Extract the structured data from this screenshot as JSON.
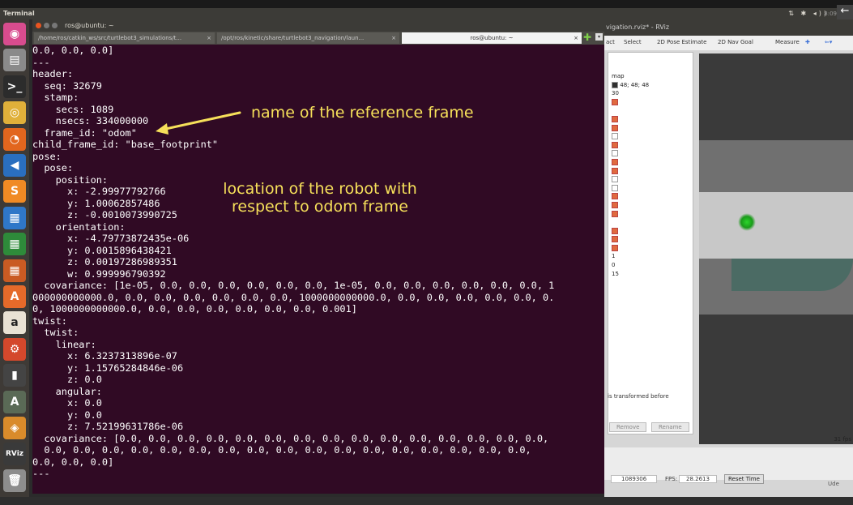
{
  "panel": {
    "app_name": "Terminal",
    "indicators": "⇅ ✱ ◂)) ",
    "clock": "8:09"
  },
  "launcher": [
    {
      "name": "ubuntu-dash-icon",
      "color": "#d84c8e",
      "glyph": "◉"
    },
    {
      "name": "files-icon",
      "color": "#8a8a8a",
      "glyph": "▤"
    },
    {
      "name": "terminal-icon",
      "color": "#2c2c2c",
      "glyph": ">_"
    },
    {
      "name": "chrome-icon",
      "color": "#e0b03a",
      "glyph": "◎"
    },
    {
      "name": "firefox-icon",
      "color": "#e2661e",
      "glyph": "◔"
    },
    {
      "name": "vscode-icon",
      "color": "#2a6fbf",
      "glyph": "◀"
    },
    {
      "name": "sublime-icon",
      "color": "#f08a24",
      "glyph": "S"
    },
    {
      "name": "writer-icon",
      "color": "#2f77c8",
      "glyph": "▦"
    },
    {
      "name": "calc-icon",
      "color": "#2e8b3a",
      "glyph": "▦"
    },
    {
      "name": "impress-icon",
      "color": "#c95b23",
      "glyph": "▦"
    },
    {
      "name": "software-center-icon",
      "color": "#e56a2a",
      "glyph": "A"
    },
    {
      "name": "amazon-icon",
      "color": "#e9e2d4",
      "glyph": "a"
    },
    {
      "name": "settings-icon",
      "color": "#d4482c",
      "glyph": "⚙"
    },
    {
      "name": "usb-drive-icon",
      "color": "#444",
      "glyph": "▮"
    },
    {
      "name": "updater-icon",
      "color": "#5a6a56",
      "glyph": "A"
    },
    {
      "name": "virtualbox-icon",
      "color": "#d98b2b",
      "glyph": "◈"
    },
    {
      "name": "rviz-icon",
      "color": "#3a3a3a",
      "glyph": "RViz"
    },
    {
      "name": "trash-icon",
      "color": "#8d8d8d",
      "glyph": "🗑"
    }
  ],
  "terminal": {
    "title": "ros@ubuntu: ~",
    "tabs": [
      "/home/ros/catkin_ws/src/turtlebot3_simulations/t...",
      "/opt/ros/kinetic/share/turtlebot3_navigation/laun...",
      "ros@ubuntu: ~"
    ],
    "lines": [
      "0.0, 0.0, 0.0]",
      "---",
      "header:",
      "  seq: 32679",
      "  stamp:",
      "    secs: 1089",
      "    nsecs: 334000000",
      "  frame_id: \"odom\"",
      "child_frame_id: \"base_footprint\"",
      "pose:",
      "  pose:",
      "    position:",
      "      x: -2.99977792766",
      "      y: 1.00062857486",
      "      z: -0.0010073990725",
      "    orientation:",
      "      x: -4.79773872435e-06",
      "      y: 0.0015896438421",
      "      z: 0.00197286989351",
      "      w: 0.999996790392",
      "  covariance: [1e-05, 0.0, 0.0, 0.0, 0.0, 0.0, 0.0, 1e-05, 0.0, 0.0, 0.0, 0.0, 0.0, 0.0, 1",
      "000000000000.0, 0.0, 0.0, 0.0, 0.0, 0.0, 0.0, 1000000000000.0, 0.0, 0.0, 0.0, 0.0, 0.0, 0.",
      "0, 1000000000000.0, 0.0, 0.0, 0.0, 0.0, 0.0, 0.0, 0.001]",
      "twist:",
      "  twist:",
      "    linear:",
      "      x: 6.3237313896e-07",
      "      y: 1.15765284846e-06",
      "      z: 0.0",
      "    angular:",
      "      x: 0.0",
      "      y: 0.0",
      "      z: 7.52199631786e-06",
      "  covariance: [0.0, 0.0, 0.0, 0.0, 0.0, 0.0, 0.0, 0.0, 0.0, 0.0, 0.0, 0.0, 0.0, 0.0, 0.0,",
      "  0.0, 0.0, 0.0, 0.0, 0.0, 0.0, 0.0, 0.0, 0.0, 0.0, 0.0, 0.0, 0.0, 0.0, 0.0, 0.0, 0.0,",
      "0.0, 0.0, 0.0]",
      "---"
    ]
  },
  "annotations": {
    "frame_note": "name of the reference frame",
    "location_note_line1": "location of the robot with",
    "location_note_line2": "respect to odom frame",
    "color": "#f6e05a"
  },
  "rviz": {
    "title": "vigation.rviz* - RViz",
    "tools": [
      "act",
      "Select",
      "2D Pose Estimate",
      "2D Nav Goal",
      "Measure"
    ],
    "display_values": [
      "map",
      "48; 48; 48",
      "30"
    ],
    "numbers": [
      "1",
      "0",
      "15"
    ],
    "desc": "is transformed before",
    "remove_label": "Remove",
    "rename_label": "Rename",
    "fps_right": "31 fps",
    "time_value": "1089306",
    "fps_label": "FPS:",
    "fps_value": "28.2613",
    "reset_label": "Reset Time",
    "watermark": "Ude"
  }
}
